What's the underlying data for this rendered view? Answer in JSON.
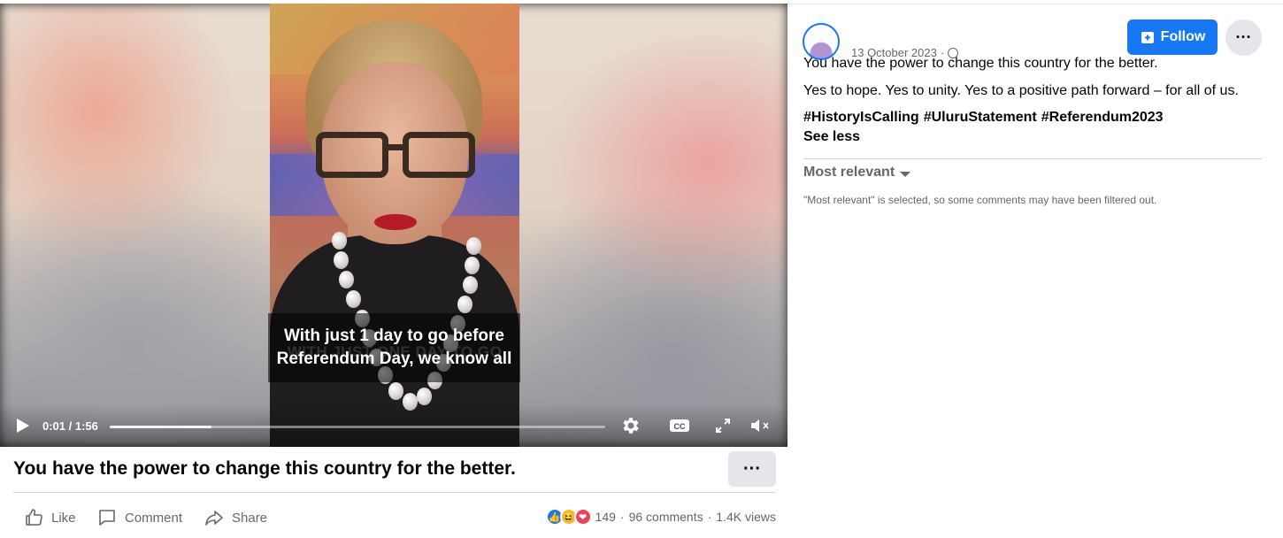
{
  "video": {
    "caption": "With just 1 day to go before Referendum Day, we know all",
    "burned_in_text": "WITH JUST ONE DAY TO GO",
    "time_display": "0:01 / 1:56",
    "progress_fraction": 0.01,
    "buffered_fraction": 0.205,
    "controls": {
      "play": "play-icon",
      "settings": "gear-icon",
      "captions": "closed-captions-icon",
      "fullscreen": "fullscreen-icon",
      "volume": "muted-volume-icon"
    }
  },
  "post": {
    "title": "You have the power to change this country for the better.",
    "more_label": "···",
    "actions": {
      "like": "Like",
      "comment": "Comment",
      "share": "Share"
    },
    "stats": {
      "reaction_count": "149",
      "separator": "·",
      "comments": "96 comments",
      "views": "1.4K views"
    }
  },
  "sidebar": {
    "date": "13 October 2023",
    "date_separator": "·",
    "follow_label": "Follow",
    "more_label": "···",
    "text_line_1": "You have the power to change this country for the better.",
    "text_line_2": "Yes to hope. Yes to unity. Yes to a positive path forward – for all of us.",
    "hashtags": [
      "#HistoryIsCalling",
      "#UluruStatement",
      "#Referendum2023"
    ],
    "see_less": "See less",
    "sort_label": "Most relevant",
    "filter_note": "\"Most relevant\" is selected, so some comments may have been filtered out."
  },
  "colors": {
    "accent": "#1877f2",
    "muted_text": "#65676b",
    "button_grey": "#e4e6eb",
    "caption_bg": "#000000"
  }
}
